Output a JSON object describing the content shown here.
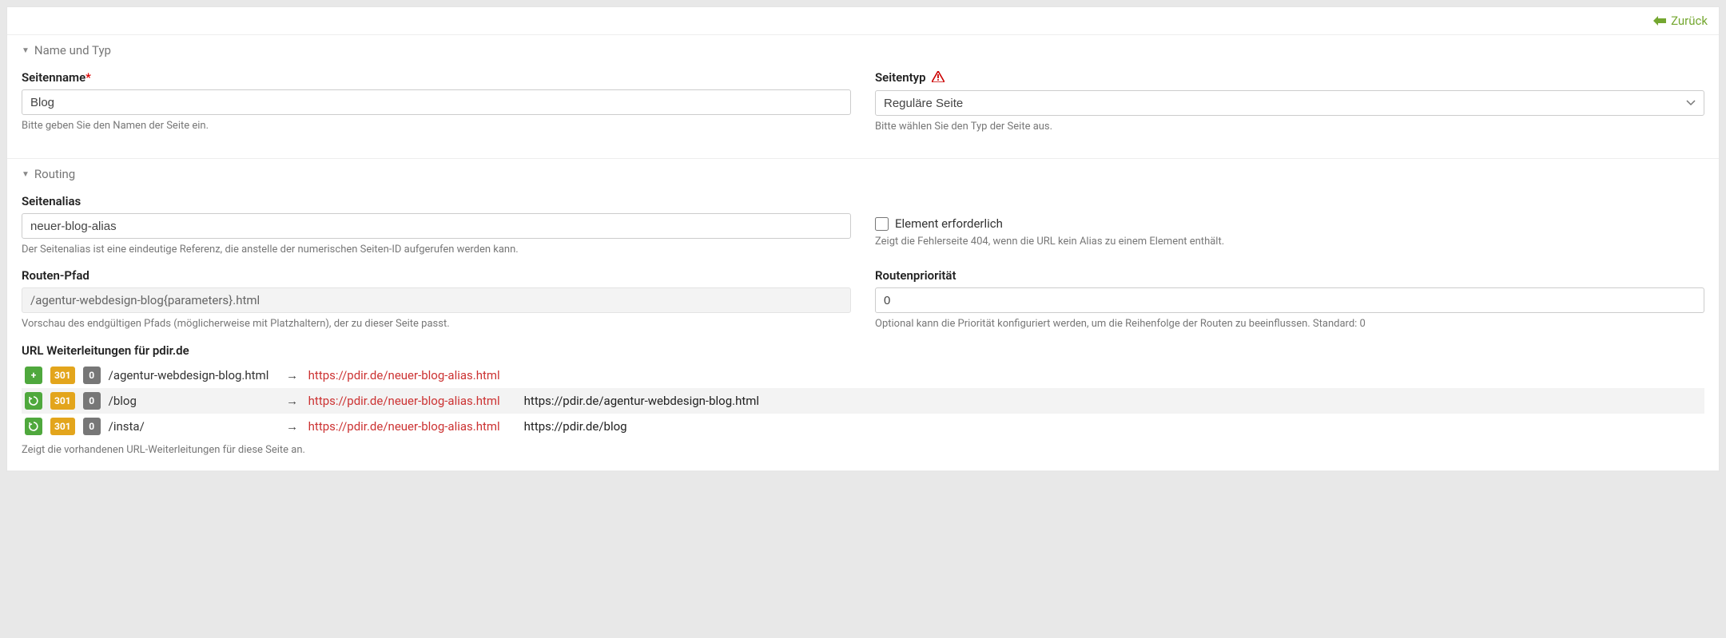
{
  "header": {
    "back_label": "Zurück"
  },
  "sec_name": {
    "title": "Name und Typ",
    "page_name": {
      "label": "Seitenname",
      "value": "Blog",
      "help": "Bitte geben Sie den Namen der Seite ein."
    },
    "page_type": {
      "label": "Seitentyp",
      "value": "Reguläre Seite",
      "help": "Bitte wählen Sie den Typ der Seite aus."
    }
  },
  "sec_routing": {
    "title": "Routing",
    "alias": {
      "label": "Seitenalias",
      "value": "neuer-blog-alias",
      "help": "Der Seitenalias ist eine eindeutige Referenz, die anstelle der numerischen Seiten-ID aufgerufen werden kann."
    },
    "required": {
      "label": "Element erforderlich",
      "help": "Zeigt die Fehlerseite 404, wenn die URL kein Alias zu einem Element enthält."
    },
    "route_path": {
      "label": "Routen-Pfad",
      "value": "/agentur-webdesign-blog{parameters}.html",
      "help": "Vorschau des endgültigen Pfads (möglicherweise mit Platzhaltern), der zu dieser Seite passt."
    },
    "priority": {
      "label": "Routenpriorität",
      "value": "0",
      "help": "Optional kann die Priorität konfiguriert werden, um die Reihenfolge der Routen zu beeinflussen. Standard: 0"
    },
    "redirects": {
      "label": "URL Weiterleitungen für pdir.de",
      "help": "Zeigt die vorhandenen URL-Weiterleitungen für diese Seite an.",
      "rows": [
        {
          "icon": "plus",
          "code": "301",
          "zero": "0",
          "src": "/agentur-webdesign-blog.html",
          "dst": "https://pdir.de/neuer-blog-alias.html",
          "old": ""
        },
        {
          "icon": "refresh",
          "code": "301",
          "zero": "0",
          "src": "/blog",
          "dst": "https://pdir.de/neuer-blog-alias.html",
          "old": "https://pdir.de/agentur-webdesign-blog.html"
        },
        {
          "icon": "refresh",
          "code": "301",
          "zero": "0",
          "src": "/insta/",
          "dst": "https://pdir.de/neuer-blog-alias.html",
          "old": "https://pdir.de/blog"
        }
      ]
    }
  }
}
